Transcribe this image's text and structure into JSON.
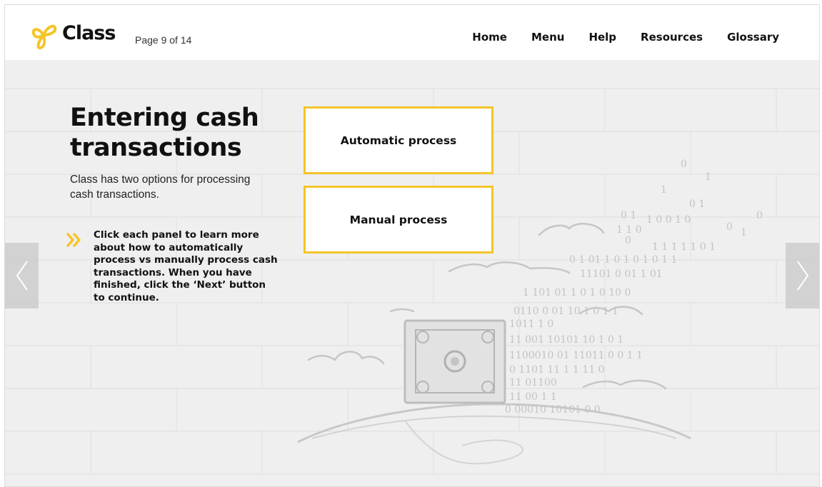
{
  "header": {
    "logo_text": "Class",
    "page_indicator": "Page 9 of 14",
    "nav": [
      "Home",
      "Menu",
      "Help",
      "Resources",
      "Glossary"
    ]
  },
  "content": {
    "title": "Entering cash transactions",
    "intro": "Class has two options for processing cash transactions.",
    "instruction": "Click each panel to learn more about how to automatically process vs manually  process cash transactions. When you have finished, click the ‘Next’ button to continue.",
    "instruction_icon": "double-chevron-right-icon"
  },
  "panels": [
    {
      "label": "Automatic process"
    },
    {
      "label": "Manual process"
    }
  ],
  "navigation": {
    "previous_icon": "chevron-left-icon",
    "next_icon": "chevron-right-icon"
  },
  "background": {
    "binary_digits": [
      "0",
      "1",
      "1",
      "0 1",
      "0 1",
      "1 0 0 1 0",
      "0",
      "0",
      "1 1 0",
      "1",
      "0",
      "1 1 1 1 1 0 1",
      "0 1 01 1 0 1 0 1 0 1 1",
      "11101 0 01 1 01",
      "1 101 01 1 0 1 0 10 0",
      "0110 0 01 10 1 0 1 1",
      "1011 1 0",
      "11 001 10101 10 1 0 1",
      "1100010 01 11011 0 0 1 1",
      "0 1101 11 1 1 11 0",
      "11 01100",
      "11 00 1 1",
      "0 00010 10101 0 0"
    ]
  },
  "colors": {
    "accent": "#f5c528",
    "background": "#efefef",
    "text": "#111111"
  }
}
